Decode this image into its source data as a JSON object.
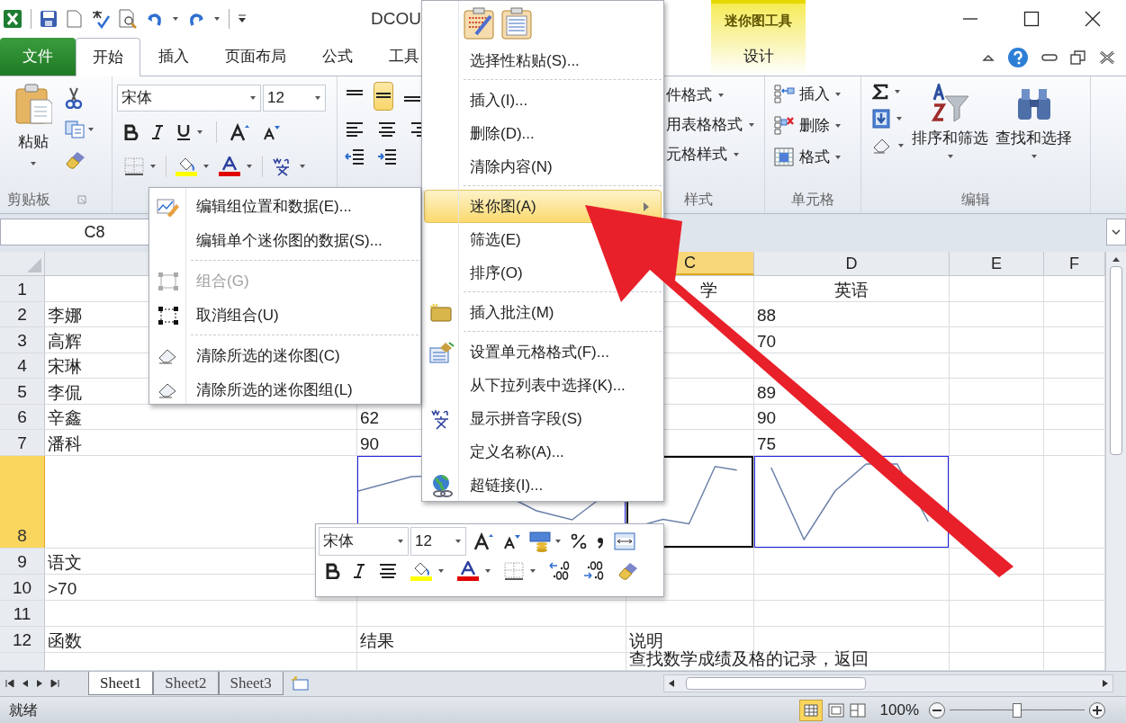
{
  "title_bar": {
    "title": "DCOU"
  },
  "ribbon_tabs": [
    {
      "label": "文件",
      "kind": "file",
      "selected": false
    },
    {
      "label": "开始",
      "kind": "tab",
      "selected": true
    },
    {
      "label": "插入",
      "kind": "tab",
      "selected": false
    },
    {
      "label": "页面布局",
      "kind": "tab",
      "selected": false
    },
    {
      "label": "公式",
      "kind": "tab",
      "selected": false
    },
    {
      "label": "工具",
      "kind": "tab",
      "selected": false
    },
    {
      "label": "设计",
      "kind": "contextual",
      "group": "迷你图工具",
      "selected": false
    }
  ],
  "ribbon": {
    "clipboard": {
      "paste": "粘贴",
      "label": "剪贴板"
    },
    "font": {
      "font_name": "宋体",
      "font_size": "12"
    },
    "styles": {
      "items": [
        "件格式",
        "用表格格式",
        "元格样式"
      ],
      "label": "样式"
    },
    "cells": {
      "items": [
        "插入",
        "删除",
        "格式"
      ],
      "label": "单元格"
    },
    "editing": {
      "sort": "排序和筛选",
      "find": "查找和选择",
      "label": "编辑"
    }
  },
  "formula_bar": {
    "name_box": "C8"
  },
  "sheet": {
    "columns": [
      {
        "label": "C",
        "selected": true
      },
      {
        "label": "D",
        "selected": false
      },
      {
        "label": "E",
        "selected": false
      },
      {
        "label": "F",
        "selected": false
      }
    ],
    "rows": [
      {
        "label": "1",
        "selected": false,
        "cells": {
          "C": "学",
          "D": "英语"
        }
      },
      {
        "label": "2",
        "selected": false,
        "cells": {
          "A": "李娜",
          "D": "88"
        }
      },
      {
        "label": "3",
        "selected": false,
        "cells": {
          "A": "高辉",
          "D": "70"
        }
      },
      {
        "label": "4",
        "selected": false,
        "cells": {
          "A": "宋琳"
        }
      },
      {
        "label": "5",
        "selected": false,
        "cells": {
          "A": "李侃",
          "D": "89"
        }
      },
      {
        "label": "6",
        "selected": false,
        "cells": {
          "A": "辛鑫",
          "B": "62",
          "D": "90"
        }
      },
      {
        "label": "7",
        "selected": false,
        "cells": {
          "A": "潘科",
          "B": "90",
          "D": "75"
        }
      },
      {
        "label": "8",
        "selected": true,
        "kind": "sparklines",
        "cells": {}
      },
      {
        "label": "9",
        "selected": false,
        "cells": {
          "A": "语文"
        }
      },
      {
        "label": "10",
        "selected": false,
        "cells": {
          "A": ">70"
        }
      },
      {
        "label": "11",
        "selected": false,
        "cells": {}
      },
      {
        "label": "12",
        "selected": false,
        "cells": {
          "A": "函数",
          "B": "结果",
          "C": "说明"
        }
      },
      {
        "cells": {
          "C": "查找数学成绩及格的记录，返回"
        }
      }
    ]
  },
  "sheet_tabs": [
    {
      "label": "Sheet1",
      "selected": true
    },
    {
      "label": "Sheet2",
      "selected": false
    },
    {
      "label": "Sheet3",
      "selected": false
    }
  ],
  "status_bar": {
    "status": "就绪",
    "zoom": "100%",
    "level": 0.5
  },
  "context_menu": {
    "items": [
      {
        "kind": "paste_options"
      },
      {
        "kind": "item",
        "label": "选择性粘贴(S)...",
        "selected": false
      },
      {
        "kind": "separator"
      },
      {
        "kind": "item",
        "label": "插入(I)...",
        "selected": false
      },
      {
        "kind": "item",
        "label": "删除(D)...",
        "selected": false
      },
      {
        "kind": "item",
        "label": "清除内容(N)",
        "selected": false
      },
      {
        "kind": "separator"
      },
      {
        "kind": "item",
        "label": "迷你图(A)",
        "selected": true,
        "submenu": true
      },
      {
        "kind": "item",
        "label": "筛选(E)",
        "selected": false
      },
      {
        "kind": "item",
        "label": "排序(O)",
        "selected": false
      },
      {
        "kind": "separator"
      },
      {
        "kind": "item",
        "label": "插入批注(M)",
        "selected": false
      },
      {
        "kind": "separator"
      },
      {
        "kind": "item",
        "label": "设置单元格格式(F)...",
        "selected": false
      },
      {
        "kind": "item",
        "label": "从下拉列表中选择(K)...",
        "selected": false
      },
      {
        "kind": "item",
        "label": "显示拼音字段(S)",
        "selected": false
      },
      {
        "kind": "item",
        "label": "定义名称(A)...",
        "selected": false
      },
      {
        "kind": "item",
        "label": "超链接(I)...",
        "selected": false
      }
    ]
  },
  "submenu": {
    "items": [
      {
        "kind": "item",
        "label": "编辑组位置和数据(E)...",
        "disabled": false
      },
      {
        "kind": "item",
        "label": "编辑单个迷你图的数据(S)...",
        "disabled": false
      },
      {
        "kind": "separator"
      },
      {
        "kind": "item",
        "label": "组合(G)",
        "disabled": true
      },
      {
        "kind": "item",
        "label": "取消组合(U)",
        "disabled": false
      },
      {
        "kind": "separator"
      },
      {
        "kind": "item",
        "label": "清除所选的迷你图(C)",
        "disabled": false
      },
      {
        "kind": "item",
        "label": "清除所选的迷你图组(L)",
        "disabled": false
      }
    ]
  },
  "mini_toolbar": {
    "font_name": "宋体",
    "font_size": "12"
  }
}
